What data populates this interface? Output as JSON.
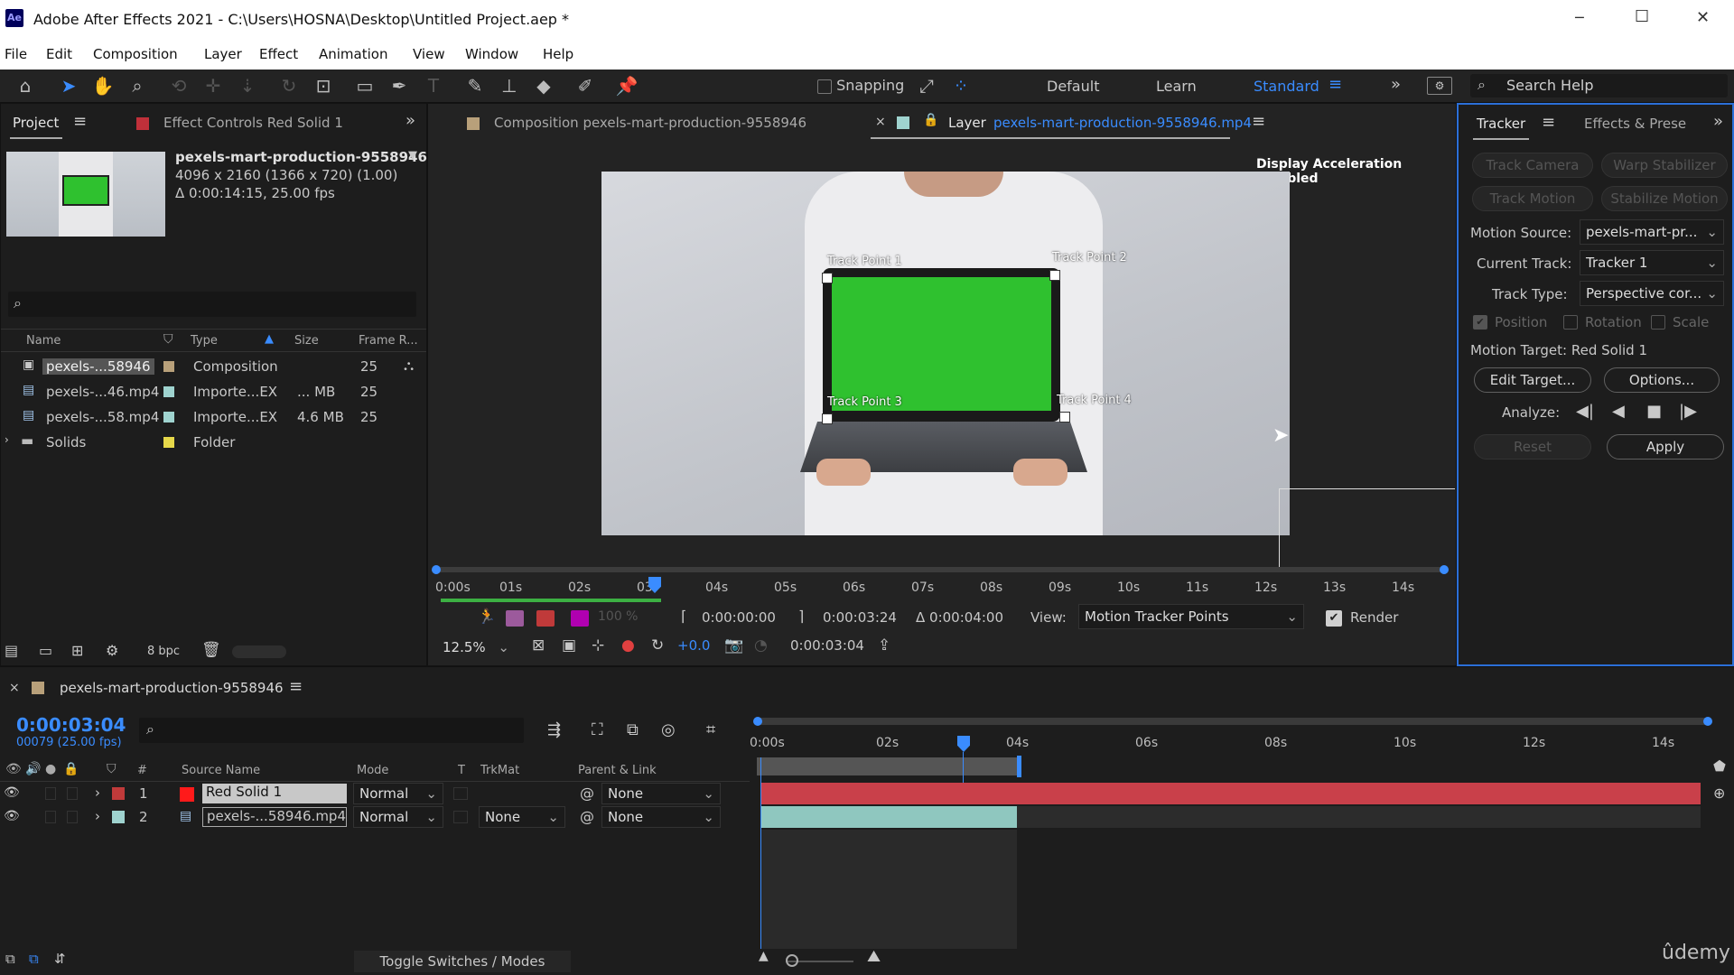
{
  "app": {
    "icon_text": "Ae",
    "title": "Adobe After Effects 2021 - C:\\Users\\HOSNA\\Desktop\\Untitled Project.aep *",
    "min": "─",
    "max": "☐",
    "close": "✕"
  },
  "menu": [
    "File",
    "Edit",
    "Composition",
    "Layer",
    "Effect",
    "Animation",
    "View",
    "Window",
    "Help"
  ],
  "toolbar": {
    "snapping": "Snapping",
    "workspaces": [
      "Default",
      "Learn",
      "Standard"
    ],
    "search_placeholder": "Search Help"
  },
  "project": {
    "tab": "Project",
    "tab2": "Effect Controls Red Solid 1",
    "item_name": "pexels-mart-production-9558946",
    "item_dims": "4096 x 2160  (1366 x 720) (1.00)",
    "item_duration": "Δ 0:00:14:15, 25.00 fps",
    "columns": [
      "Name",
      "Type",
      "Size",
      "Frame R..."
    ],
    "rows": [
      {
        "name": "pexels-...58946",
        "type": "Composition",
        "size": "",
        "fr": "25",
        "color": "#b8a07a"
      },
      {
        "name": "pexels-...46.mp4",
        "type": "Importe...EX",
        "size": "... MB",
        "fr": "25",
        "color": "#9fd3cf"
      },
      {
        "name": "pexels-...58.mp4",
        "type": "Importe...EX",
        "size": "4.6 MB",
        "fr": "25",
        "color": "#9fd3cf"
      },
      {
        "name": "Solids",
        "type": "Folder",
        "size": "",
        "fr": "",
        "color": "#e6d84a"
      }
    ],
    "bpc": "8 bpc"
  },
  "viewer": {
    "comp_tab": "Composition pexels-mart-production-9558946",
    "layer_tab_prefix": "Layer",
    "layer_tab": "pexels-mart-production-9558946.mp4",
    "accel": "Display Acceleration Disabled",
    "track_points": [
      "Track Point 1",
      "Track Point 2",
      "Track Point 3",
      "Track Point 4"
    ],
    "ticks": [
      "0:00s",
      "01s",
      "02s",
      "03",
      "04s",
      "05s",
      "06s",
      "07s",
      "08s",
      "09s",
      "10s",
      "11s",
      "12s",
      "13s",
      "14s"
    ],
    "in_time": "0:00:00:00",
    "out_time": "0:00:03:24",
    "duration": "Δ 0:00:04:00",
    "view_label": "View:",
    "view_value": "Motion Tracker Points",
    "render_label": "Render",
    "zoom": "12.5%",
    "exposure": "+0.0",
    "current_time": "0:00:03:04",
    "opacity": "100 %"
  },
  "tracker": {
    "tab": "Tracker",
    "tab2": "Effects & Prese",
    "buttons": [
      "Track Camera",
      "Warp Stabilizer",
      "Track Motion",
      "Stabilize Motion"
    ],
    "motion_source_label": "Motion Source:",
    "motion_source": "pexels-mart-pr...",
    "current_track_label": "Current Track:",
    "current_track": "Tracker 1",
    "track_type_label": "Track Type:",
    "track_type": "Perspective cor...",
    "checks": [
      "Position",
      "Rotation",
      "Scale"
    ],
    "motion_target": "Motion Target:  Red Solid 1",
    "edit_target": "Edit Target...",
    "options": "Options...",
    "analyze": "Analyze:",
    "reset": "Reset",
    "apply": "Apply"
  },
  "timeline": {
    "tab": "pexels-mart-production-9558946",
    "timecode": "0:00:03:04",
    "frames": "00079 (25.00 fps)",
    "columns": [
      "#",
      "Source Name",
      "Mode",
      "T",
      "TrkMat",
      "Parent & Link"
    ],
    "ticks": [
      "0:00s",
      "02s",
      "04s",
      "06s",
      "08s",
      "10s",
      "12s",
      "14s"
    ],
    "layers": [
      {
        "num": "1",
        "name": "Red Solid 1",
        "mode": "Normal",
        "trkmat": "",
        "parent": "None",
        "color": "#c03a3a"
      },
      {
        "num": "2",
        "name": "pexels-...58946.mp4",
        "mode": "Normal",
        "trkmat": "None",
        "parent": "None",
        "color": "#9fd3cf"
      }
    ],
    "toggle": "Toggle Switches / Modes"
  },
  "watermark": "ûdemy"
}
